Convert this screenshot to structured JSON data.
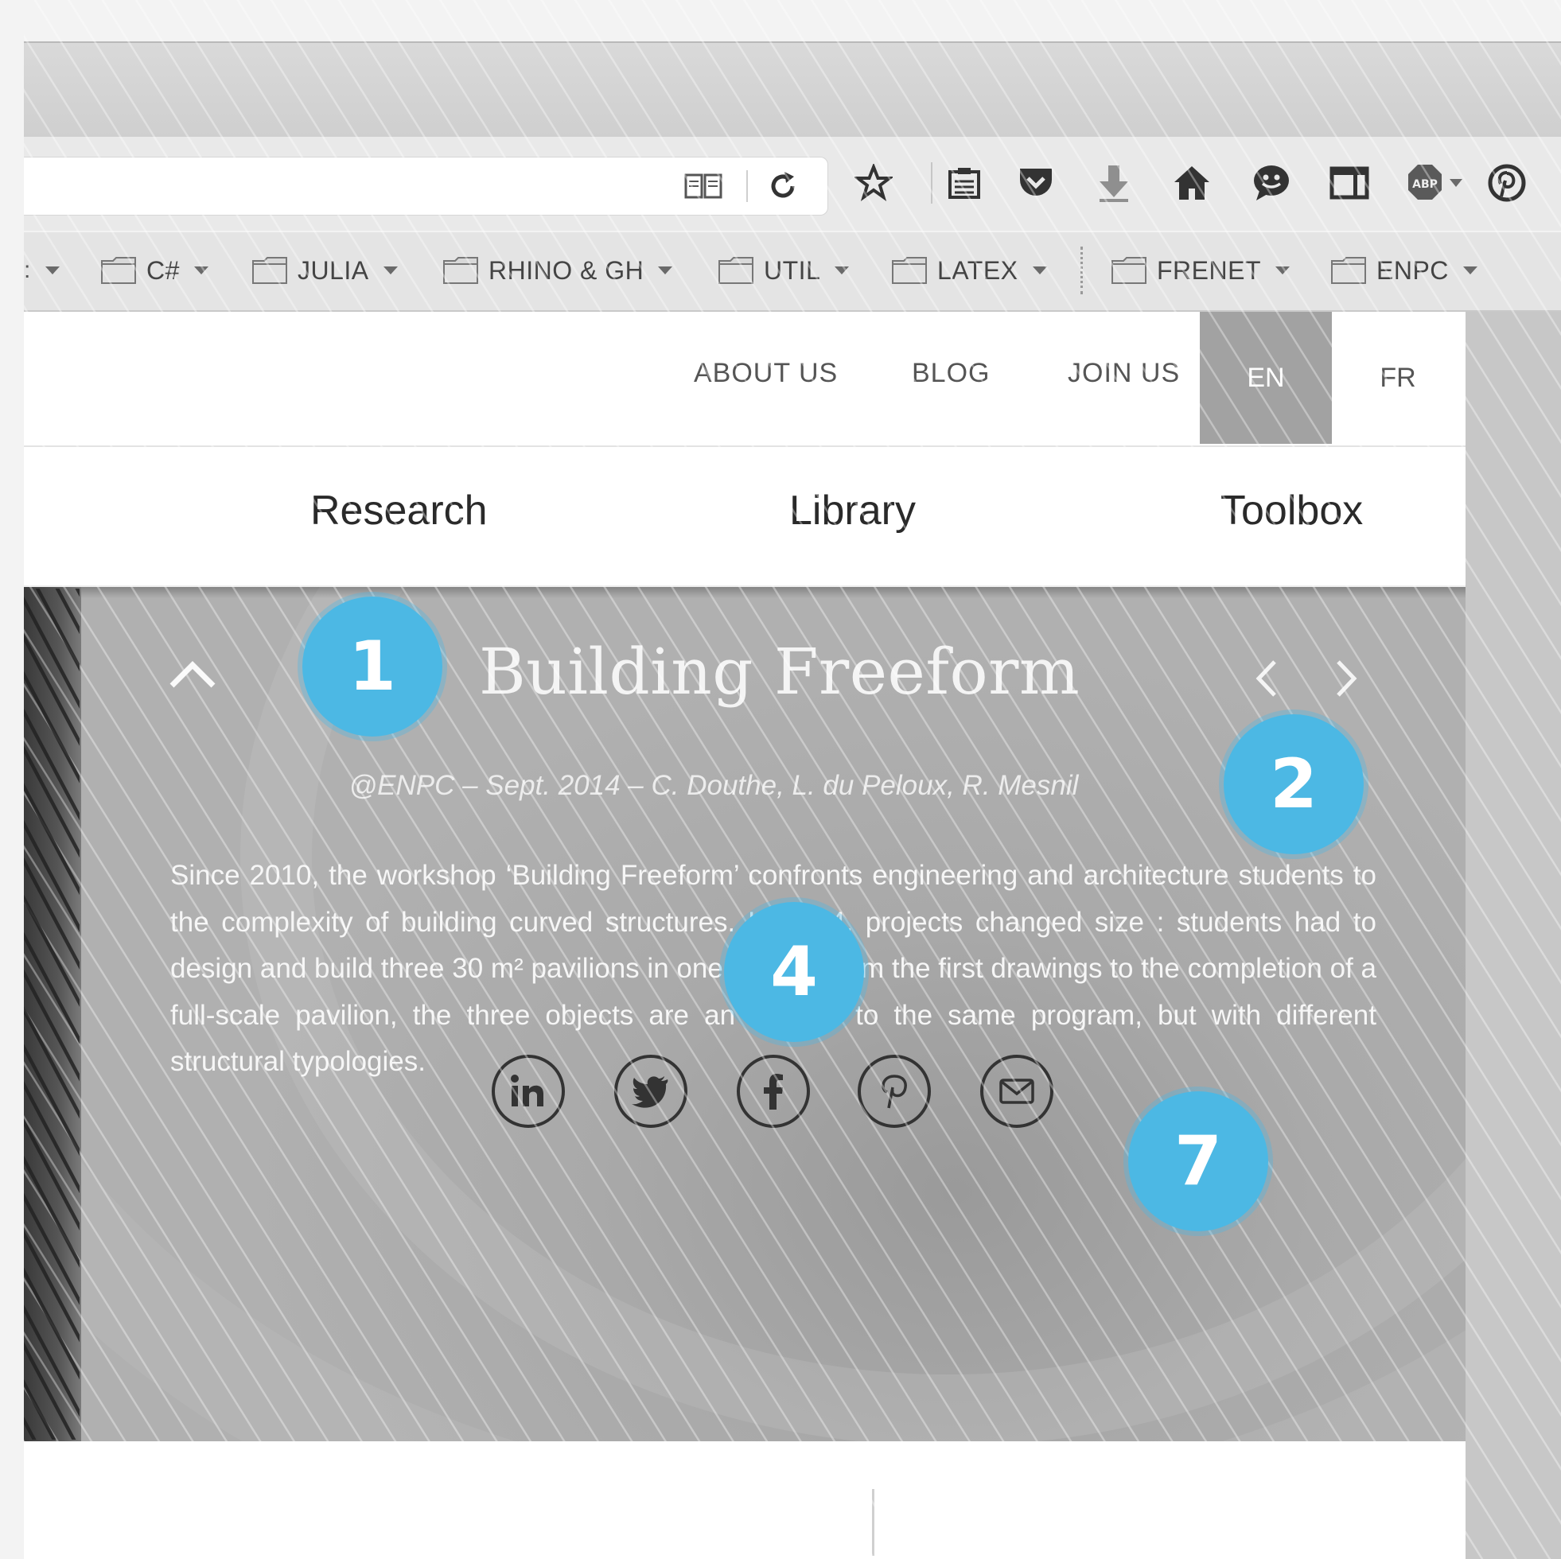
{
  "bookmarks": {
    "items": [
      {
        "label": "C#"
      },
      {
        "label": "JULIA"
      },
      {
        "label": "RHINO & GH"
      },
      {
        "label": "UTIL"
      },
      {
        "label": "LATEX"
      },
      {
        "label": "FRENET"
      },
      {
        "label": "ENPC"
      }
    ]
  },
  "toolbar": {
    "icons": [
      "reader-view-icon",
      "reload-icon",
      "bookmark-star-icon",
      "bookmarks-list-icon",
      "pocket-icon",
      "downloads-icon",
      "home-icon",
      "chat-icon",
      "sidebar-icon",
      "adblock-icon",
      "pinterest-icon"
    ],
    "adblock_label": "ABP"
  },
  "site": {
    "top_nav": {
      "about": "ABOUT US",
      "blog": "BLOG",
      "join": "JOIN US",
      "lang_en": "EN",
      "lang_fr": "FR"
    },
    "main_nav": {
      "research": "Research",
      "library": "Library",
      "toolbox": "Toolbox"
    },
    "hero": {
      "title": "Building Freeform",
      "subtitle": "@ENPC – Sept. 2014 – C. Douthe, L. du Peloux, R. Mesnil",
      "body": "Since 2010, the workshop ‘Building Freeform’ confronts engineering and architecture students to the complexity of building curved structures. In 2014, projects changed size : students had to design and build three 30 m² pavilions in one week ! From the first drawings to the completion of a full-scale pavilion, the three objects are an answer to the same program, but with different structural typologies.",
      "social": [
        "linkedin-icon",
        "twitter-icon",
        "facebook-icon",
        "pinterest-icon",
        "email-icon"
      ]
    }
  },
  "markers": [
    {
      "label": "1"
    },
    {
      "label": "2"
    },
    {
      "label": "4"
    },
    {
      "label": "7"
    }
  ],
  "colors": {
    "marker": "#4cb8e4",
    "lang_active": "#a2a2a2"
  }
}
